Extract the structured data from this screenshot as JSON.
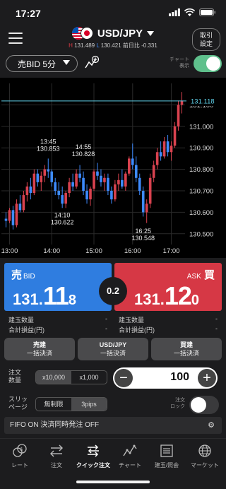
{
  "status": {
    "time": "17:27"
  },
  "header": {
    "pair": "USD/JPY",
    "high_label": "H",
    "high": "131.489",
    "low_label": "L",
    "low": "130.421",
    "change_label": "前日比",
    "change": "-0.331",
    "torihiki_line1": "取引",
    "torihiki_line2": "設定"
  },
  "toolbar": {
    "chart_type": "売BID",
    "timeframe": "5分",
    "toggle_label_1": "チャート",
    "toggle_label_2": "表示",
    "chart_shown": true
  },
  "chart_data": {
    "type": "candlestick",
    "current_price": "131.118",
    "y_ticks": [
      "131.100",
      "131.000",
      "130.900",
      "130.800",
      "130.700",
      "130.600",
      "130.500"
    ],
    "ylim": [
      130.45,
      131.2
    ],
    "x_ticks": [
      "13:00",
      "14:00",
      "15:00",
      "16:00",
      "17:00"
    ],
    "annotations": [
      {
        "time": "13:45",
        "price": "130.853"
      },
      {
        "time": "14:10",
        "price": "130.622"
      },
      {
        "time": "14:55",
        "price": "130.828"
      },
      {
        "time": "16:25",
        "price": "130.548"
      }
    ],
    "candles": [
      [
        130.57,
        130.6,
        130.53,
        130.56
      ],
      [
        130.56,
        130.62,
        130.55,
        130.61
      ],
      [
        130.61,
        130.63,
        130.52,
        130.54
      ],
      [
        130.54,
        130.66,
        130.53,
        130.64
      ],
      [
        130.64,
        130.68,
        130.6,
        130.61
      ],
      [
        130.61,
        130.7,
        130.6,
        130.68
      ],
      [
        130.68,
        130.74,
        130.65,
        130.72
      ],
      [
        130.72,
        130.76,
        130.66,
        130.69
      ],
      [
        130.69,
        130.8,
        130.68,
        130.78
      ],
      [
        130.78,
        130.8,
        130.72,
        130.74
      ],
      [
        130.74,
        130.79,
        130.7,
        130.77
      ],
      [
        130.77,
        130.82,
        130.74,
        130.8
      ],
      [
        130.8,
        130.85,
        130.76,
        130.79
      ],
      [
        130.79,
        130.8,
        130.72,
        130.74
      ],
      [
        130.74,
        130.76,
        130.68,
        130.7
      ],
      [
        130.7,
        130.74,
        130.66,
        130.68
      ],
      [
        130.68,
        130.72,
        130.62,
        130.64
      ],
      [
        130.64,
        130.7,
        130.62,
        130.69
      ],
      [
        130.69,
        130.76,
        130.67,
        130.74
      ],
      [
        130.74,
        130.78,
        130.7,
        130.72
      ],
      [
        130.72,
        130.8,
        130.71,
        130.78
      ],
      [
        130.78,
        130.82,
        130.74,
        130.76
      ],
      [
        130.76,
        130.79,
        130.68,
        130.7
      ],
      [
        130.7,
        130.73,
        130.64,
        130.66
      ],
      [
        130.66,
        130.72,
        130.63,
        130.71
      ],
      [
        130.71,
        130.8,
        130.7,
        130.79
      ],
      [
        130.79,
        130.83,
        130.75,
        130.77
      ],
      [
        130.77,
        130.8,
        130.72,
        130.74
      ],
      [
        130.74,
        130.78,
        130.7,
        130.76
      ],
      [
        130.76,
        130.78,
        130.68,
        130.7
      ],
      [
        130.7,
        130.72,
        130.64,
        130.66
      ],
      [
        130.66,
        130.75,
        130.65,
        130.73
      ],
      [
        130.73,
        130.78,
        130.7,
        130.75
      ],
      [
        130.75,
        130.8,
        130.71,
        130.72
      ],
      [
        130.72,
        130.79,
        130.7,
        130.78
      ],
      [
        130.78,
        130.86,
        130.77,
        130.85
      ],
      [
        130.85,
        130.92,
        130.8,
        130.82
      ],
      [
        130.82,
        130.86,
        130.74,
        130.76
      ],
      [
        130.76,
        130.78,
        130.68,
        130.7
      ],
      [
        130.7,
        130.72,
        130.58,
        130.6
      ],
      [
        130.6,
        130.66,
        130.55,
        130.64
      ],
      [
        130.64,
        130.78,
        130.62,
        130.76
      ],
      [
        130.76,
        130.84,
        130.74,
        130.82
      ],
      [
        130.82,
        130.9,
        130.8,
        130.88
      ],
      [
        130.88,
        130.93,
        130.84,
        130.86
      ],
      [
        130.86,
        130.95,
        130.85,
        130.93
      ],
      [
        130.93,
        130.96,
        130.86,
        130.88
      ],
      [
        130.88,
        130.93,
        130.84,
        130.91
      ],
      [
        130.91,
        131.02,
        130.9,
        131.0
      ],
      [
        131.0,
        131.12,
        130.98,
        131.1
      ],
      [
        131.1,
        131.16,
        131.06,
        131.12
      ]
    ]
  },
  "sell": {
    "label": "売",
    "sub": "BID",
    "p1": "131.",
    "p2": "11",
    "p3": "8"
  },
  "buy": {
    "label": "買",
    "sub": "ASK",
    "p1": "131.",
    "p2": "12",
    "p3": "0"
  },
  "spread": "0.2",
  "position": {
    "qty_label": "建玉数量",
    "pl_label": "合計損益(円)",
    "dash": "-"
  },
  "settle": {
    "sell_1": "売建",
    "sell_2": "一括決済",
    "pair_1": "USD/JPY",
    "pair_2": "一括決済",
    "buy_1": "買建",
    "buy_2": "一括決済"
  },
  "order": {
    "qty_label_1": "注文",
    "qty_label_2": "数量",
    "unit_a": "x10,000",
    "unit_b": "x1,000",
    "minus": "−",
    "plus": "+",
    "qty": "100",
    "slip_label_1": "スリッ",
    "slip_label_2": "ページ",
    "slip_a": "無制限",
    "slip_b": "3pips",
    "lock_label_1": "注文",
    "lock_label_2": "ロック",
    "order_lock_on": false
  },
  "fifo": {
    "text": "FIFO ON 決済同時発注 OFF"
  },
  "tabs": [
    {
      "label": "レート",
      "icon": "rate-icon"
    },
    {
      "label": "注文",
      "icon": "order-icon"
    },
    {
      "label": "クイック注文",
      "icon": "quick-order-icon"
    },
    {
      "label": "チャート",
      "icon": "chart-icon"
    },
    {
      "label": "建玉/照会",
      "icon": "position-icon"
    },
    {
      "label": "マーケット",
      "icon": "market-icon"
    }
  ],
  "colors": {
    "sell": "#2f7de0",
    "buy": "#d63845",
    "up_candle": "#d9424f",
    "down_candle": "#3d8bff",
    "price_line": "#5fd0e8",
    "toggle_on": "#5fc08c"
  }
}
